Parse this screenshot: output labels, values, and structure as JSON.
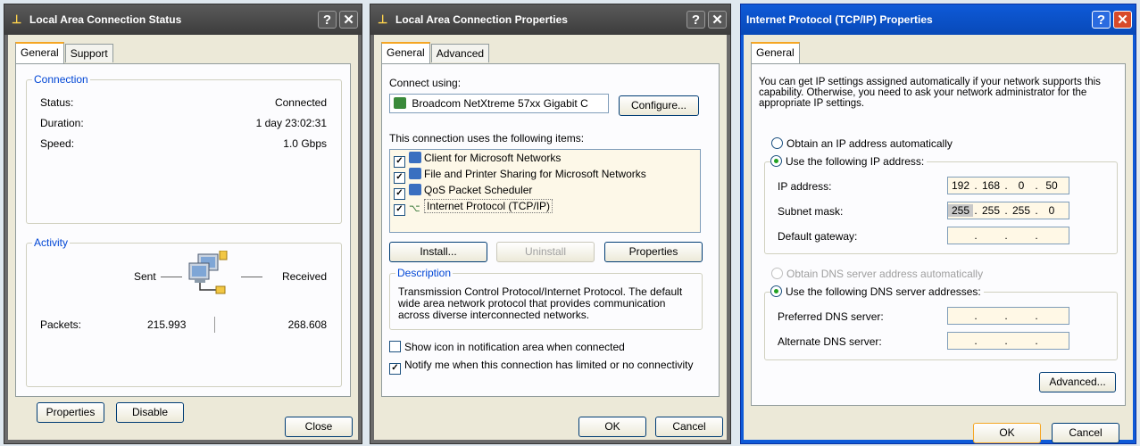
{
  "status": {
    "title": "Local Area Connection Status",
    "tabs": [
      "General",
      "Support"
    ],
    "connection_label": "Connection",
    "status_label": "Status:",
    "status_value": "Connected",
    "duration_label": "Duration:",
    "duration_value": "1 day 23:02:31",
    "speed_label": "Speed:",
    "speed_value": "1.0 Gbps",
    "activity_label": "Activity",
    "sent_label": "Sent",
    "received_label": "Received",
    "packets_label": "Packets:",
    "packets_sent": "215.993",
    "packets_received": "268.608",
    "properties_button": "Properties",
    "disable_button": "Disable",
    "close_button": "Close"
  },
  "props": {
    "title": "Local Area Connection Properties",
    "tabs": [
      "General",
      "Advanced"
    ],
    "connect_using_label": "Connect using:",
    "adapter": "Broadcom NetXtreme 57xx Gigabit C",
    "configure_button": "Configure...",
    "items_label": "This connection uses the following items:",
    "items": [
      {
        "label": "Client for Microsoft Networks",
        "checked": true,
        "icon": "network-client-icon"
      },
      {
        "label": "File and Printer Sharing for Microsoft Networks",
        "checked": true,
        "icon": "file-printer-sharing-icon"
      },
      {
        "label": "QoS Packet Scheduler",
        "checked": true,
        "icon": "qos-scheduler-icon"
      },
      {
        "label": "Internet Protocol (TCP/IP)",
        "checked": true,
        "icon": "protocol-icon"
      }
    ],
    "install_button": "Install...",
    "uninstall_button": "Uninstall",
    "properties_button": "Properties",
    "description_label": "Description",
    "description_text": "Transmission Control Protocol/Internet Protocol. The default wide area network protocol that provides communication across diverse interconnected networks.",
    "show_icon_label": "Show icon in notification area when connected",
    "notify_label": "Notify me when this connection has limited or no connectivity",
    "ok_button": "OK",
    "cancel_button": "Cancel"
  },
  "tcpip": {
    "title": "Internet Protocol (TCP/IP) Properties",
    "tab": "General",
    "intro": "You can get IP settings assigned automatically if your network supports this capability. Otherwise, you need to ask your network administrator for the appropriate IP settings.",
    "obtain_ip_label": "Obtain an IP address automatically",
    "use_ip_label": "Use the following IP address:",
    "ip_address_label": "IP address:",
    "ip_address": [
      "192",
      "168",
      "0",
      "50"
    ],
    "subnet_label": "Subnet mask:",
    "subnet": [
      "255",
      "255",
      "255",
      "0"
    ],
    "gateway_label": "Default gateway:",
    "obtain_dns_label": "Obtain DNS server address automatically",
    "use_dns_label": "Use the following DNS server addresses:",
    "preferred_dns_label": "Preferred DNS server:",
    "alternate_dns_label": "Alternate DNS server:",
    "advanced_button": "Advanced...",
    "ok_button": "OK",
    "cancel_button": "Cancel"
  },
  "colors": {
    "group_label": "#0046d5",
    "dialog_bg": "#ece9d8",
    "title_blue": "#0e5ad8",
    "title_gray": "#3c3c3c"
  }
}
